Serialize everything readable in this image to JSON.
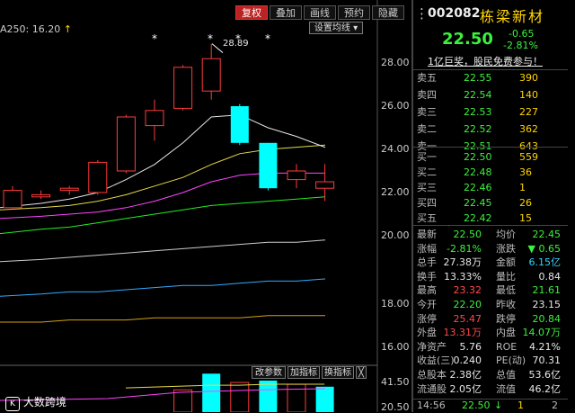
{
  "toolbar": {
    "fuquan": "复权",
    "overlay": "叠加",
    "draw": "画线",
    "appoint": "预约",
    "hide": "隐藏"
  },
  "chart": {
    "ma_label": "A250: 16.20",
    "settings": "设置均线",
    "ticks": [
      "28.00",
      "26.00",
      "24.00",
      "22.00",
      "20.00",
      "18.00",
      "16.00"
    ],
    "high_note": "28.89",
    "vol_ticks": [
      "41.50",
      "20.50"
    ],
    "buttons": {
      "edit": "改参数",
      "add": "加指标",
      "swap": "换指标",
      "close": "╳"
    },
    "watermark": "大数跨境",
    "colors": {
      "up": "#ff3b3b",
      "down": "#00ffff",
      "ma_white": "#e6e6e6",
      "ma_yellow": "#e6d94a",
      "ma_magenta": "#ff44ff",
      "ma_green": "#22ee22",
      "ma_gray": "#cccccc",
      "ma_blue": "#33aaff",
      "ma_gold": "#d4a017"
    }
  },
  "stock": {
    "code": "002082",
    "name": "栋梁新材",
    "price": "22.50",
    "change": "-0.65",
    "change_pct": "-2.81%",
    "ad": "1亿巨奖，股民免费参与！"
  },
  "orderbook": {
    "sells": [
      {
        "label": "卖五",
        "price": "22.55",
        "vol": "390"
      },
      {
        "label": "卖四",
        "price": "22.54",
        "vol": "140"
      },
      {
        "label": "卖三",
        "price": "22.53",
        "vol": "227"
      },
      {
        "label": "卖二",
        "price": "22.52",
        "vol": "362"
      },
      {
        "label": "卖一",
        "price": "22.51",
        "vol": "643"
      }
    ],
    "buys": [
      {
        "label": "买一",
        "price": "22.50",
        "vol": "559"
      },
      {
        "label": "买二",
        "price": "22.48",
        "vol": "36"
      },
      {
        "label": "买三",
        "price": "22.46",
        "vol": "1"
      },
      {
        "label": "买四",
        "price": "22.45",
        "vol": "26"
      },
      {
        "label": "买五",
        "price": "22.42",
        "vol": "15"
      }
    ]
  },
  "stats": [
    {
      "l1": "最新",
      "v1": "22.50",
      "c1": "green",
      "l2": "均价",
      "v2": "22.45",
      "c2": "green"
    },
    {
      "l1": "涨幅",
      "v1": "-2.81%",
      "c1": "green",
      "l2": "涨跌",
      "v2": "▼ 0.65",
      "c2": "green"
    },
    {
      "l1": "总手",
      "v1": "27.38万",
      "c1": "white",
      "l2": "金额",
      "v2": "6.15亿",
      "c2": "cyan"
    },
    {
      "l1": "换手",
      "v1": "13.33%",
      "c1": "white",
      "l2": "量比",
      "v2": "0.84",
      "c2": "white"
    },
    {
      "l1": "最高",
      "v1": "23.32",
      "c1": "red",
      "l2": "最低",
      "v2": "21.61",
      "c2": "green"
    },
    {
      "l1": "今开",
      "v1": "22.20",
      "c1": "green",
      "l2": "昨收",
      "v2": "23.15",
      "c2": "white"
    },
    {
      "l1": "涨停",
      "v1": "25.47",
      "c1": "red",
      "l2": "跌停",
      "v2": "20.84",
      "c2": "green"
    },
    {
      "l1": "外盘",
      "v1": "13.31万",
      "c1": "red",
      "l2": "内盘",
      "v2": "14.07万",
      "c2": "green"
    },
    {
      "l1": "净资产",
      "v1": "5.76",
      "c1": "white",
      "l2": "ROE",
      "v2": "4.21%",
      "c2": "white"
    },
    {
      "l1": "收益(三)",
      "v1": "0.240",
      "c1": "white",
      "l2": "PE(动)",
      "v2": "70.31",
      "c2": "white"
    },
    {
      "l1": "总股本",
      "v1": "2.38亿",
      "c1": "white",
      "l2": "总值",
      "v2": "53.6亿",
      "c2": "white"
    },
    {
      "l1": "流通股",
      "v1": "2.05亿",
      "c1": "white",
      "l2": "流值",
      "v2": "46.2亿",
      "c2": "white"
    }
  ],
  "tick": {
    "time": "14:56",
    "price": "22.50",
    "arrow": "↓",
    "vol": "1",
    "num": "2"
  },
  "chart_data": {
    "type": "candlestick",
    "ylim": [
      15.5,
      29.6
    ],
    "candles": [
      {
        "o": 21.3,
        "c": 22.1,
        "h": 22.3,
        "l": 21.2
      },
      {
        "o": 21.8,
        "c": 21.9,
        "h": 22.1,
        "l": 21.7
      },
      {
        "o": 22.1,
        "c": 22.2,
        "h": 22.3,
        "l": 21.9
      },
      {
        "o": 22.0,
        "c": 23.4,
        "h": 23.5,
        "l": 21.9
      },
      {
        "o": 23.0,
        "c": 25.5,
        "h": 25.6,
        "l": 22.9
      },
      {
        "o": 25.1,
        "c": 25.8,
        "h": 26.3,
        "l": 24.4
      },
      {
        "o": 25.9,
        "c": 27.8,
        "h": 27.9,
        "l": 25.8
      },
      {
        "o": 26.7,
        "c": 28.2,
        "h": 28.89,
        "l": 26.3
      },
      {
        "o": 26.0,
        "c": 24.3,
        "h": 26.1,
        "l": 24.2
      },
      {
        "o": 24.3,
        "c": 22.2,
        "h": 24.3,
        "l": 22.1
      },
      {
        "o": 22.6,
        "c": 23.0,
        "h": 23.32,
        "l": 22.2
      },
      {
        "o": 22.2,
        "c": 22.5,
        "h": 23.32,
        "l": 21.61
      }
    ],
    "volume": [
      {
        "v": 0,
        "up": true
      },
      {
        "v": 0,
        "up": true
      },
      {
        "v": 0,
        "up": true
      },
      {
        "v": 0,
        "up": true
      },
      {
        "v": 0,
        "up": true
      },
      {
        "v": 0,
        "up": true
      },
      {
        "v": 24,
        "up": true
      },
      {
        "v": 41.5,
        "up": false
      },
      {
        "v": 32,
        "up": true
      },
      {
        "v": 34,
        "up": false
      },
      {
        "v": 30,
        "up": true
      },
      {
        "v": 27.4,
        "up": false
      }
    ],
    "ma_white": [
      21.3,
      21.5,
      21.7,
      22.0,
      22.6,
      23.3,
      24.3,
      25.5,
      25.6,
      25.0,
      24.6,
      24.1
    ],
    "ma_yellow": [
      21.2,
      21.3,
      21.4,
      21.6,
      21.9,
      22.3,
      22.7,
      23.3,
      23.8,
      24.0,
      24.1,
      24.2
    ],
    "ma_magenta": [
      20.8,
      20.9,
      21.0,
      21.1,
      21.3,
      21.6,
      22.0,
      22.5,
      22.8,
      22.9,
      22.9,
      22.9
    ],
    "ma_green": [
      20.1,
      20.3,
      20.4,
      20.6,
      20.8,
      21.0,
      21.2,
      21.4,
      21.5,
      21.6,
      21.7,
      21.8
    ],
    "ma_gray": [
      18.8,
      18.9,
      19.0,
      19.1,
      19.2,
      19.3,
      19.4,
      19.5,
      19.6,
      19.7,
      19.7,
      19.8
    ],
    "ma_blue": [
      17.2,
      17.3,
      17.4,
      17.4,
      17.5,
      17.6,
      17.7,
      17.7,
      17.8,
      17.9,
      17.9,
      18.0
    ],
    "ma_gold": [
      16.0,
      16.0,
      16.1,
      16.1,
      16.1,
      16.2,
      16.2,
      16.2,
      16.2,
      16.3,
      16.3,
      16.3
    ],
    "vol_ma": [
      28,
      29,
      30,
      31,
      31,
      32,
      32,
      32
    ]
  }
}
